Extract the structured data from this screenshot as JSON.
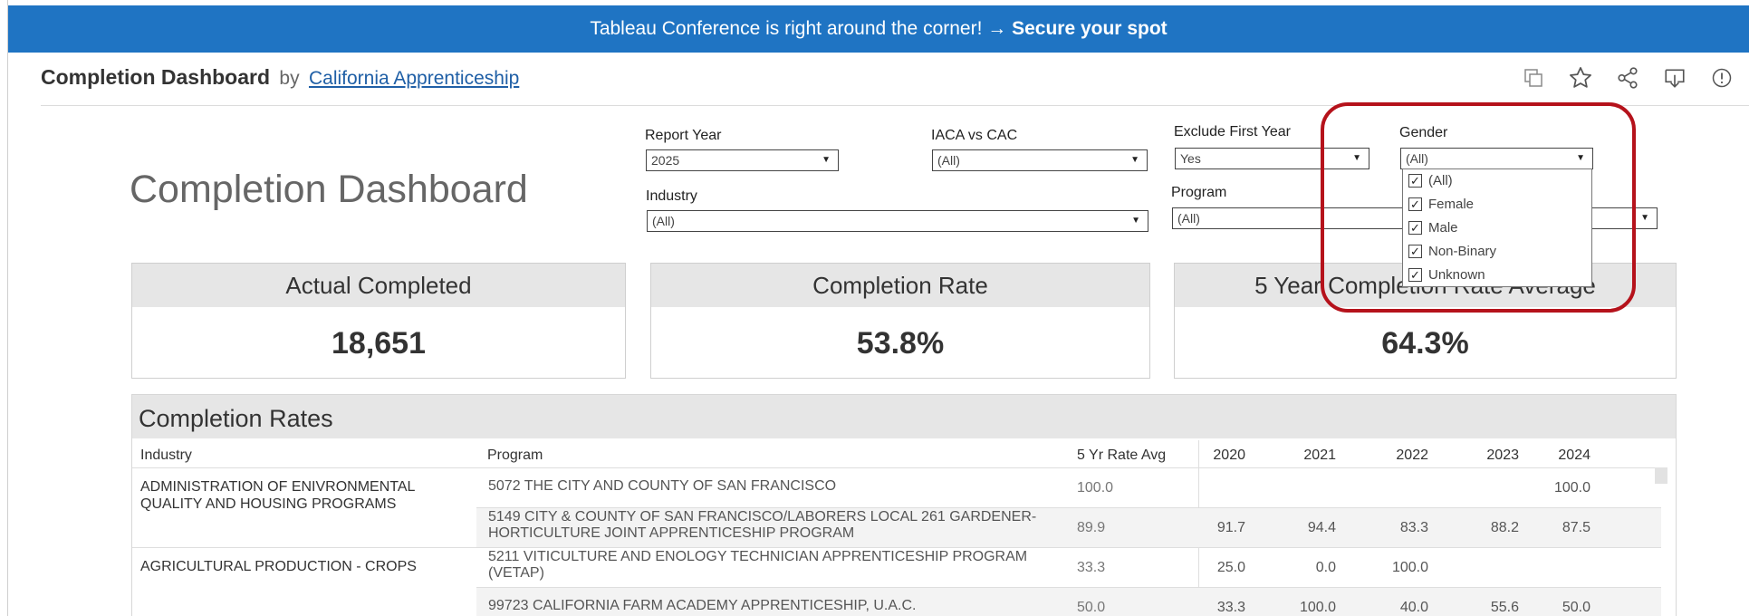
{
  "banner": {
    "text": "Tableau Conference is right around the corner! → ",
    "link": "Secure your spot"
  },
  "header": {
    "name": "Completion Dashboard",
    "by": "by",
    "author": "California Apprenticeship",
    "icons": [
      "copy-icon",
      "star-icon",
      "share-icon",
      "download-icon",
      "info-icon"
    ]
  },
  "dashboard_title": "Completion Dashboard",
  "filters": {
    "report_year": {
      "label": "Report Year",
      "value": "2025"
    },
    "iaca_cac": {
      "label": "IACA vs CAC",
      "value": "(All)"
    },
    "exclude_first_year": {
      "label": "Exclude First Year",
      "value": "Yes"
    },
    "gender": {
      "label": "Gender",
      "value": "(All)",
      "options": [
        "(All)",
        "Female",
        "Male",
        "Non-Binary",
        "Unknown"
      ]
    },
    "industry": {
      "label": "Industry",
      "value": "(All)"
    },
    "program": {
      "label": "Program",
      "value": "(All)"
    }
  },
  "kpis": {
    "actual_completed": {
      "label": "Actual Completed",
      "value": "18,651"
    },
    "completion_rate": {
      "label": "Completion Rate",
      "value": "53.8%"
    },
    "five_year": {
      "label": "5 Year Completion Rate Average",
      "value": "64.3%"
    }
  },
  "table": {
    "title": "Completion Rates",
    "columns": {
      "industry": "Industry",
      "program": "Program",
      "avg": "5 Yr Rate Avg",
      "y2020": "2020",
      "y2021": "2021",
      "y2022": "2022",
      "y2023": "2023",
      "y2024": "2024"
    },
    "rows": [
      {
        "industry": "ADMINISTRATION OF ENIVRONMENTAL QUALITY AND HOUSING PROGRAMS",
        "program": "5072 THE CITY AND COUNTY OF SAN FRANCISCO",
        "avg": "100.0",
        "y2020": "",
        "y2021": "",
        "y2022": "",
        "y2023": "",
        "y2024": "100.0"
      },
      {
        "industry": "",
        "program": "5149 CITY & COUNTY OF SAN FRANCISCO/LABORERS LOCAL 261 GARDENER-HORTICULTURE JOINT APPRENTICESHIP PROGRAM",
        "avg": "89.9",
        "y2020": "91.7",
        "y2021": "94.4",
        "y2022": "83.3",
        "y2023": "88.2",
        "y2024": "87.5"
      },
      {
        "industry": "AGRICULTURAL PRODUCTION - CROPS",
        "program": "5211 VITICULTURE AND ENOLOGY TECHNICIAN APPRENTICESHIP PROGRAM (VETAP)",
        "avg": "33.3",
        "y2020": "25.0",
        "y2021": "0.0",
        "y2022": "100.0",
        "y2023": "",
        "y2024": ""
      },
      {
        "industry": "",
        "program": "99723 CALIFORNIA FARM ACADEMY APPRENTICESHIP, U.A.C.",
        "avg": "50.0",
        "y2020": "33.3",
        "y2021": "100.0",
        "y2022": "40.0",
        "y2023": "55.6",
        "y2024": "50.0"
      }
    ]
  }
}
